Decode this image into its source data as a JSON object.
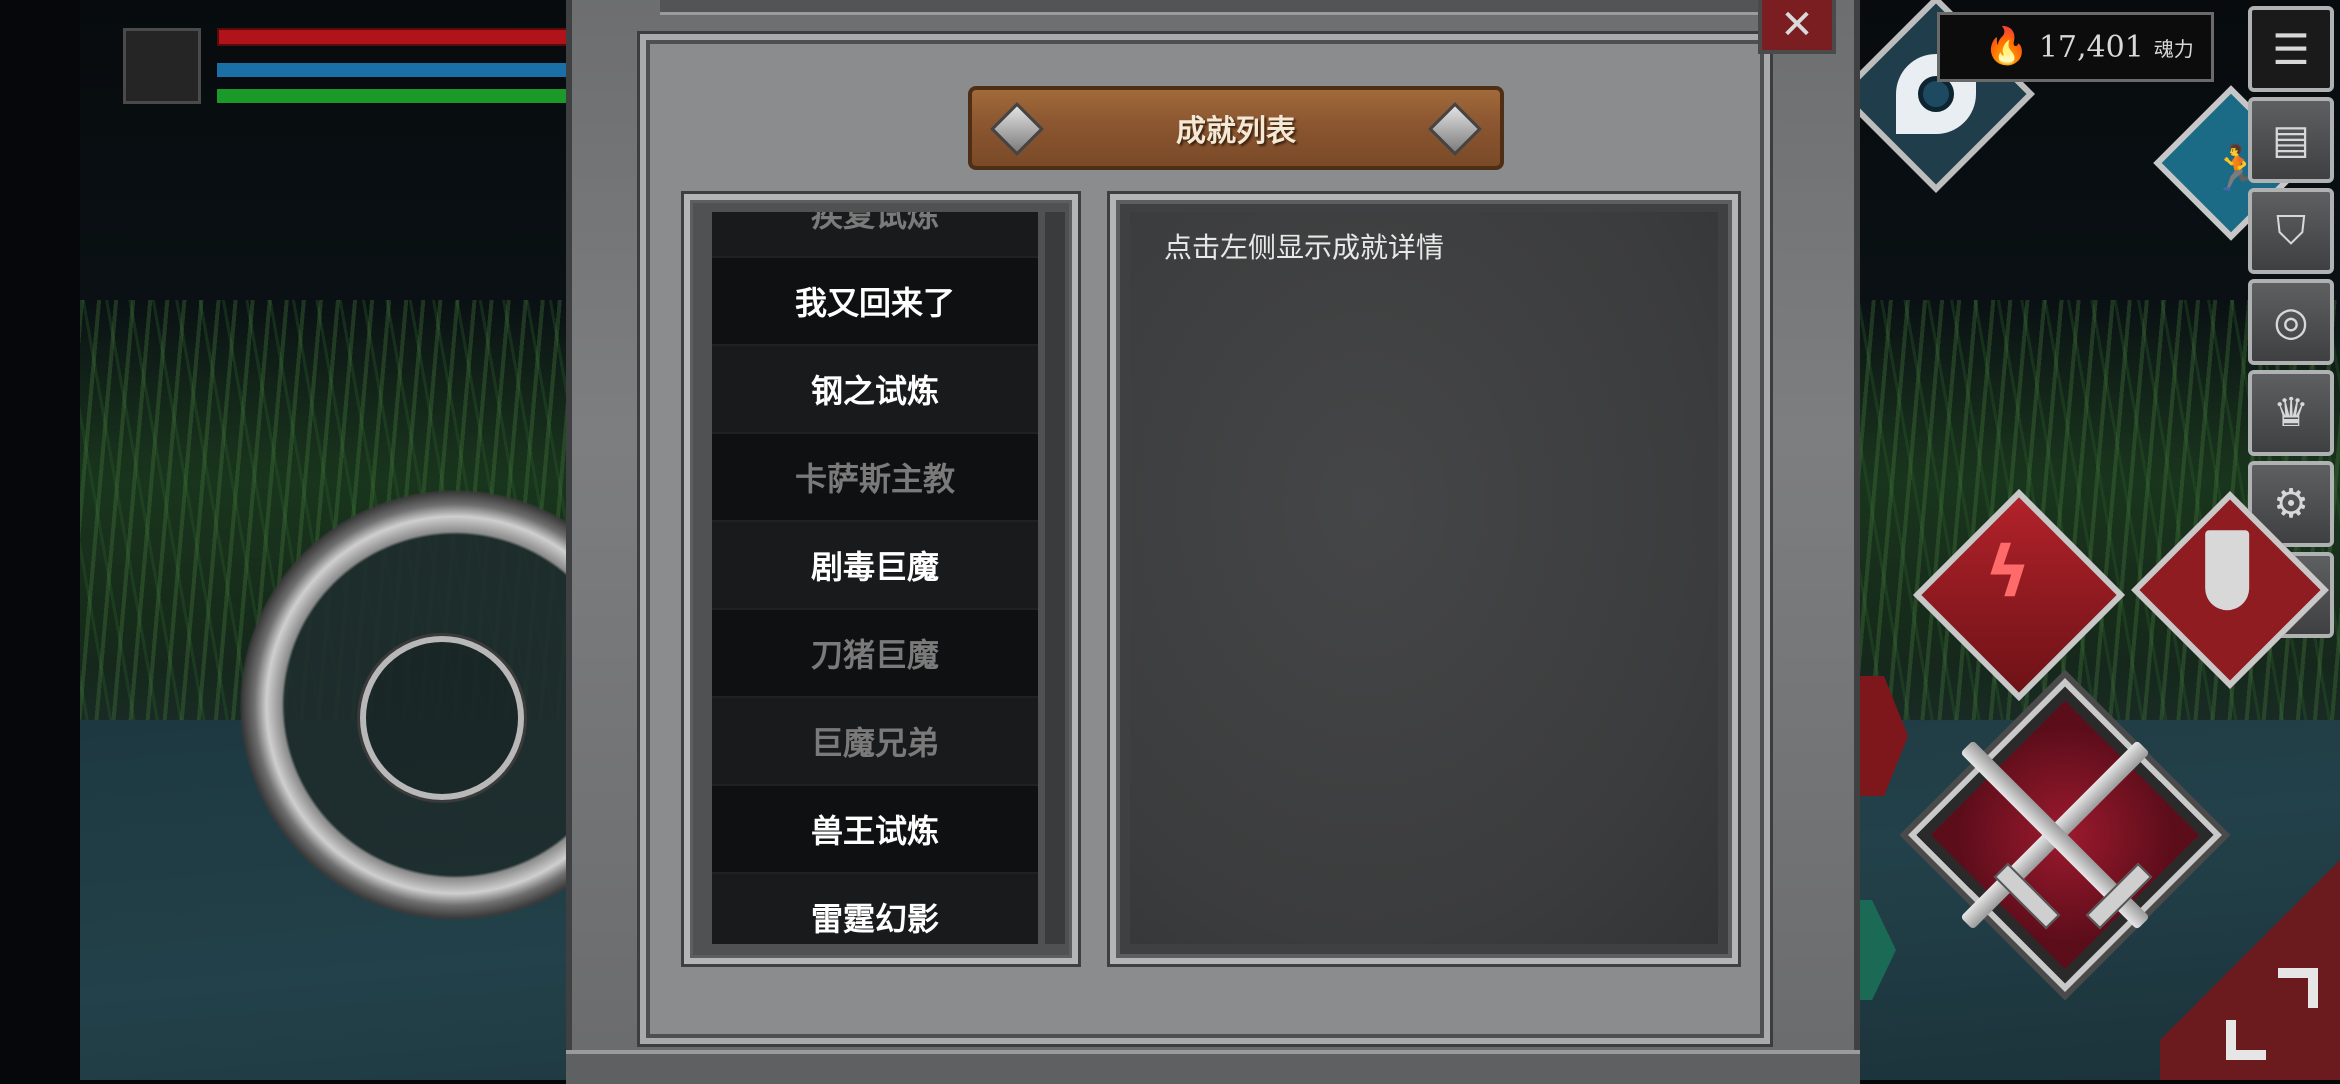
{
  "panel": {
    "title": "成就列表",
    "close_icon": "close-icon"
  },
  "achievements": [
    {
      "label": "疾复试炼",
      "state": "partial-hidden"
    },
    {
      "label": "我又回来了",
      "state": "unlocked"
    },
    {
      "label": "钢之试炼",
      "state": "unlocked"
    },
    {
      "label": "卡萨斯主教",
      "state": "locked"
    },
    {
      "label": "剧毒巨魔",
      "state": "unlocked"
    },
    {
      "label": "刀猪巨魔",
      "state": "locked"
    },
    {
      "label": "巨魔兄弟",
      "state": "locked"
    },
    {
      "label": "兽王试炼",
      "state": "unlocked"
    },
    {
      "label": "雷霆幻影",
      "state": "unlocked"
    }
  ],
  "detail": {
    "hint": "点击左侧显示成就详情"
  },
  "hud": {
    "soul_value": "17,401",
    "soul_unit": "魂力",
    "flame_glyph": "🔥",
    "side_buttons": [
      {
        "name": "menu-icon",
        "glyph": "☰"
      },
      {
        "name": "map-icon",
        "glyph": "▤"
      },
      {
        "name": "helmet-icon",
        "glyph": "⛉"
      },
      {
        "name": "emblem-icon",
        "glyph": "◎"
      },
      {
        "name": "crown-icon",
        "glyph": "♛"
      },
      {
        "name": "gear-icon",
        "glyph": "⚙"
      },
      {
        "name": "help-icon",
        "glyph": "?"
      }
    ]
  },
  "colors": {
    "hp": "#b0141a",
    "mp": "#1a6fa6",
    "stamina": "#1b9a2a",
    "plank": "#8b5630",
    "unlocked_text": "#ffffff",
    "locked_text": "#7a7a7a"
  }
}
